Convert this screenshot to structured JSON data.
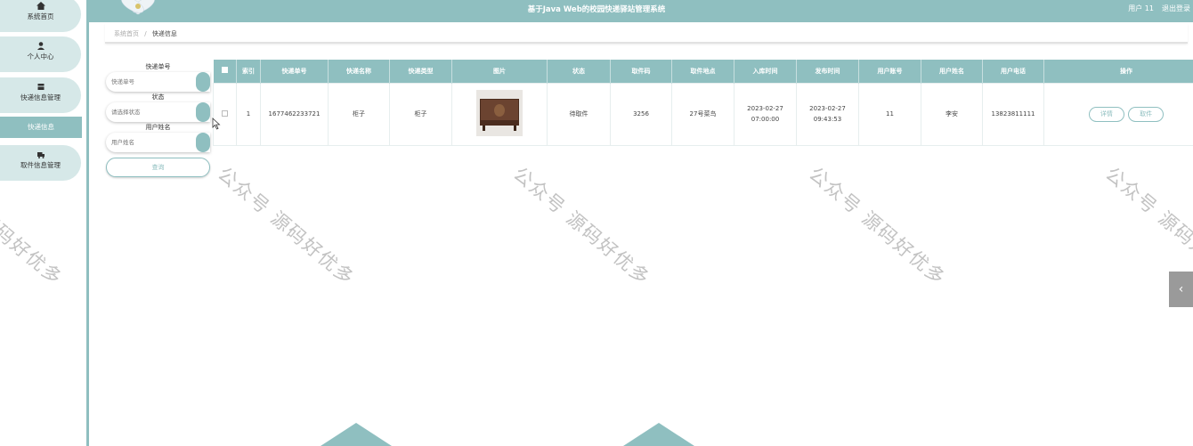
{
  "header": {
    "title": "基于Java Web的校园快递驿站管理系统",
    "user_label": "用户 11",
    "logout": "退出登录"
  },
  "sidebar": {
    "items": [
      {
        "label": "系统首页",
        "icon": "home-icon"
      },
      {
        "label": "个人中心",
        "icon": "user-icon"
      },
      {
        "label": "快递信息管理",
        "icon": "box-icon"
      },
      {
        "label": "取件信息管理",
        "icon": "truck-icon"
      }
    ],
    "sub_active": "快递信息"
  },
  "breadcrumb": {
    "home": "系统首页",
    "sep": "/",
    "current": "快递信息"
  },
  "search": {
    "fields": [
      {
        "label": "快递单号",
        "placeholder": "快递单号"
      },
      {
        "label": "状态",
        "placeholder": "请选择状态"
      },
      {
        "label": "用户姓名",
        "placeholder": "用户姓名"
      }
    ],
    "button": "查询"
  },
  "table": {
    "headers": [
      "索引",
      "快递单号",
      "快递名称",
      "快递类型",
      "图片",
      "状态",
      "取件码",
      "取件地点",
      "入库时间",
      "发布时间",
      "用户账号",
      "用户姓名",
      "用户电话",
      "操作"
    ],
    "rows": [
      {
        "index": "1",
        "tracking_no": "1677462233721",
        "name": "柜子",
        "type": "柜子",
        "status": "待取件",
        "pickup_code": "3256",
        "pickup_place": "27号菜鸟",
        "in_time": "2023-02-27 07:00:00",
        "pub_time": "2023-02-27 09:43:53",
        "account": "11",
        "user_name": "李安",
        "phone": "13823811111",
        "btn_detail": "详情",
        "btn_pickup": "取件"
      }
    ]
  },
  "watermark": "公众号 源码好优多",
  "colors": {
    "accent": "#8fbfc0",
    "accent_light": "#d6e8e8",
    "toggle": "#9a9a9a"
  }
}
